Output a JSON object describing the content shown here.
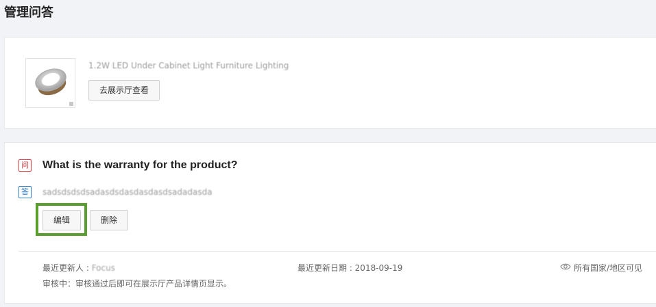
{
  "page": {
    "title": "管理问答"
  },
  "product": {
    "name": "1.2W LED Under Cabinet Light Furniture Lighting",
    "showroom_button": "去展示厅查看"
  },
  "qa": {
    "question_tag": "问",
    "answer_tag": "答",
    "question": "What is the warranty for the product?",
    "answer": "sadsdsdsdsadasdsdasdasdasdsadadasda",
    "edit_button": "编辑",
    "delete_button": "删除",
    "updater_label": "最近更新人 : ",
    "updater_name": "Focus",
    "update_date": "最近更新日期 : 2018-09-19",
    "visibility": "所有国家/地区可见",
    "review_status": "审核中：审核通过后即可在展示厅产品详情页显示。"
  },
  "colors": {
    "highlight": "#5a9e2f",
    "question_tag": "#e0393e",
    "answer_tag": "#2b79c8"
  },
  "icons": {
    "visibility": "eye-icon",
    "product_image": "product-thumbnail"
  }
}
